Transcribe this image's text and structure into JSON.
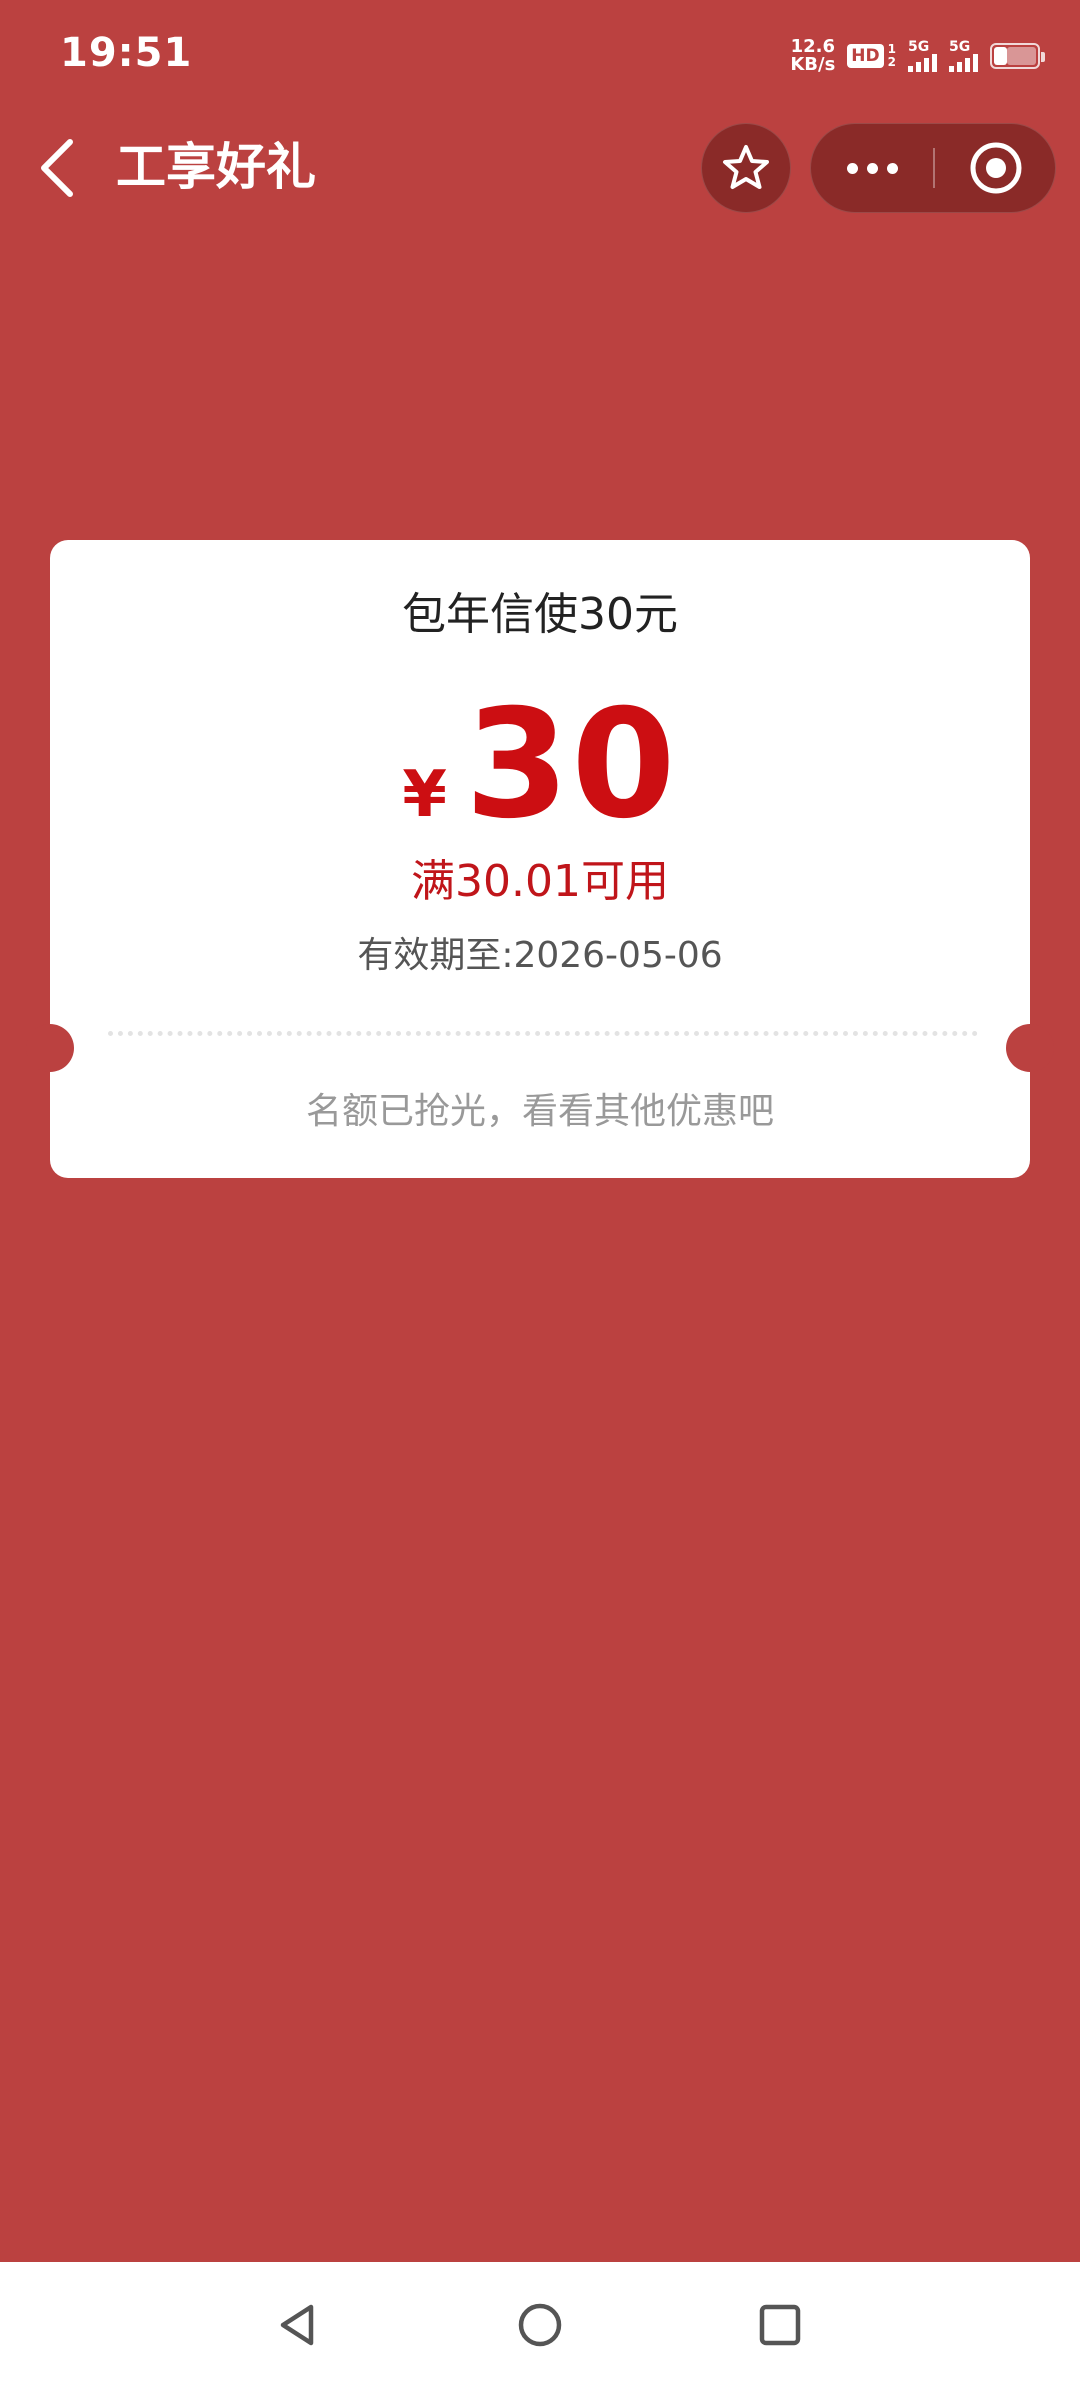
{
  "status_bar": {
    "time": "19:51",
    "net_speed_value": "12.6",
    "net_speed_unit": "KB/s",
    "hd_label": "HD",
    "hd_sim_top": "1",
    "hd_sim_bottom": "2",
    "signal1_label": "5G",
    "signal2_label": "5G",
    "battery_level": 0.3
  },
  "nav": {
    "title": "工享好礼"
  },
  "coupon": {
    "title": "包年信使30元",
    "currency": "¥",
    "amount": "30",
    "condition": "满30.01可用",
    "validity": "有效期至:2026-05-06",
    "status": "名额已抢光，看看其他优惠吧"
  },
  "colors": {
    "background": "#bb4140",
    "accent": "#cc0e12"
  },
  "icons": {
    "back": "chevron-left-icon",
    "favorite": "star-icon",
    "more": "more-dots-icon",
    "close": "target-icon",
    "nav_back": "triangle-back-icon",
    "nav_home": "circle-home-icon",
    "nav_recent": "square-recent-icon"
  }
}
